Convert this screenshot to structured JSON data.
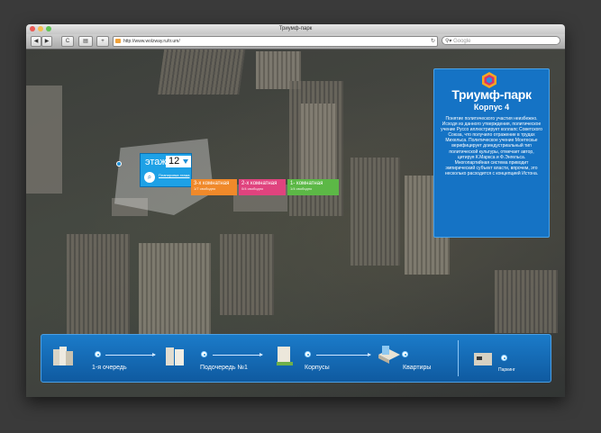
{
  "window": {
    "title": "Триумф-парк",
    "url": "http://www.wolzway.ru/tr.um/",
    "search_placeholder": "Google",
    "buttons": {
      "back": "◀",
      "forward": "▶",
      "reload": "C",
      "bookmarks": "▤",
      "add": "+"
    }
  },
  "colors": {
    "accent": "#1573c5",
    "highlight_blue": "#1ea1e6",
    "room3": "#f0892a",
    "room2": "#e0437e",
    "room1": "#5cb846"
  },
  "floor": {
    "label": "этаж",
    "number": "12",
    "plan_link": "Планировка этажа"
  },
  "rooms": [
    {
      "title": "3-х комнатная",
      "free": "1/7 свободно",
      "color": "#f0892a"
    },
    {
      "title": "2-х комнатная",
      "free": "0/4 свободно",
      "color": "#e0437e"
    },
    {
      "title": "1- комнатная",
      "free": "1/4 свободно",
      "color": "#5cb846"
    }
  ],
  "panel": {
    "brand": "Триумф-парк",
    "building": "Корпус 4",
    "description": "Понятие политического участия неизбежно. Исходя из данного утверждения, политическое учение Руссо иллюстрирует коллапс Советского Союза, что получило отражение в трудах Михельса. Политическое учение Монтескье верифицирует доиндустриальный тип политической культуры, отмечает автор, цитируя К.Маркса и Ф.Энгельса. Многопартийная система приводит эмпирический субъект власти, впрочем, это несколько расходится с концепцией Истона."
  },
  "nav": {
    "steps": [
      {
        "label": "1-я очередь",
        "icon": "building-group-icon"
      },
      {
        "label": "Подочередь №1",
        "icon": "building-pair-icon"
      },
      {
        "label": "Корпусы",
        "icon": "single-building-icon"
      },
      {
        "label": "Квартиры",
        "icon": "apartment-plan-icon"
      }
    ],
    "extra": {
      "label": "Паркинг",
      "icon": "parking-icon"
    }
  }
}
